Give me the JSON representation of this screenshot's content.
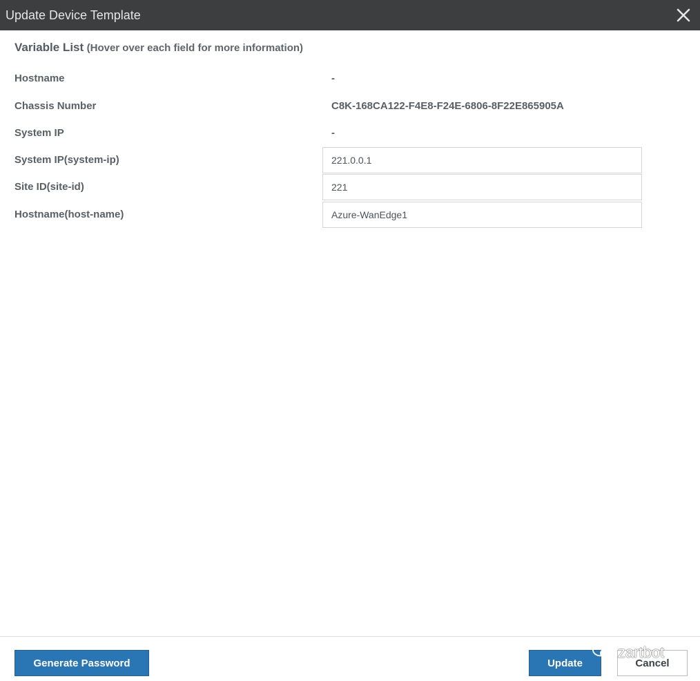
{
  "dialog": {
    "title": "Update Device Template"
  },
  "variable_list": {
    "heading": "Variable List",
    "hint": "(Hover over each field for more information)"
  },
  "fields": {
    "hostname": {
      "label": "Hostname",
      "value": "-"
    },
    "chassis_number": {
      "label": "Chassis Number",
      "value": "C8K-168CA122-F4E8-F24E-6806-8F22E865905A"
    },
    "system_ip": {
      "label": "System IP",
      "value": "-"
    },
    "system_ip_var": {
      "label": "System IP(system-ip)",
      "value": "221.0.0.1"
    },
    "site_id_var": {
      "label": "Site ID(site-id)",
      "value": "221"
    },
    "hostname_var": {
      "label": "Hostname(host-name)",
      "value": "Azure-WanEdge1"
    }
  },
  "footer": {
    "generate_password_label": "Generate Password",
    "update_label": "Update",
    "cancel_label": "Cancel"
  },
  "watermark": {
    "text": "zartbot"
  },
  "icons": {
    "close": "close-icon",
    "watermark": "wechat-icon"
  },
  "colors": {
    "titlebar": "#3d3e40",
    "primary_button": "#2a76b4"
  }
}
